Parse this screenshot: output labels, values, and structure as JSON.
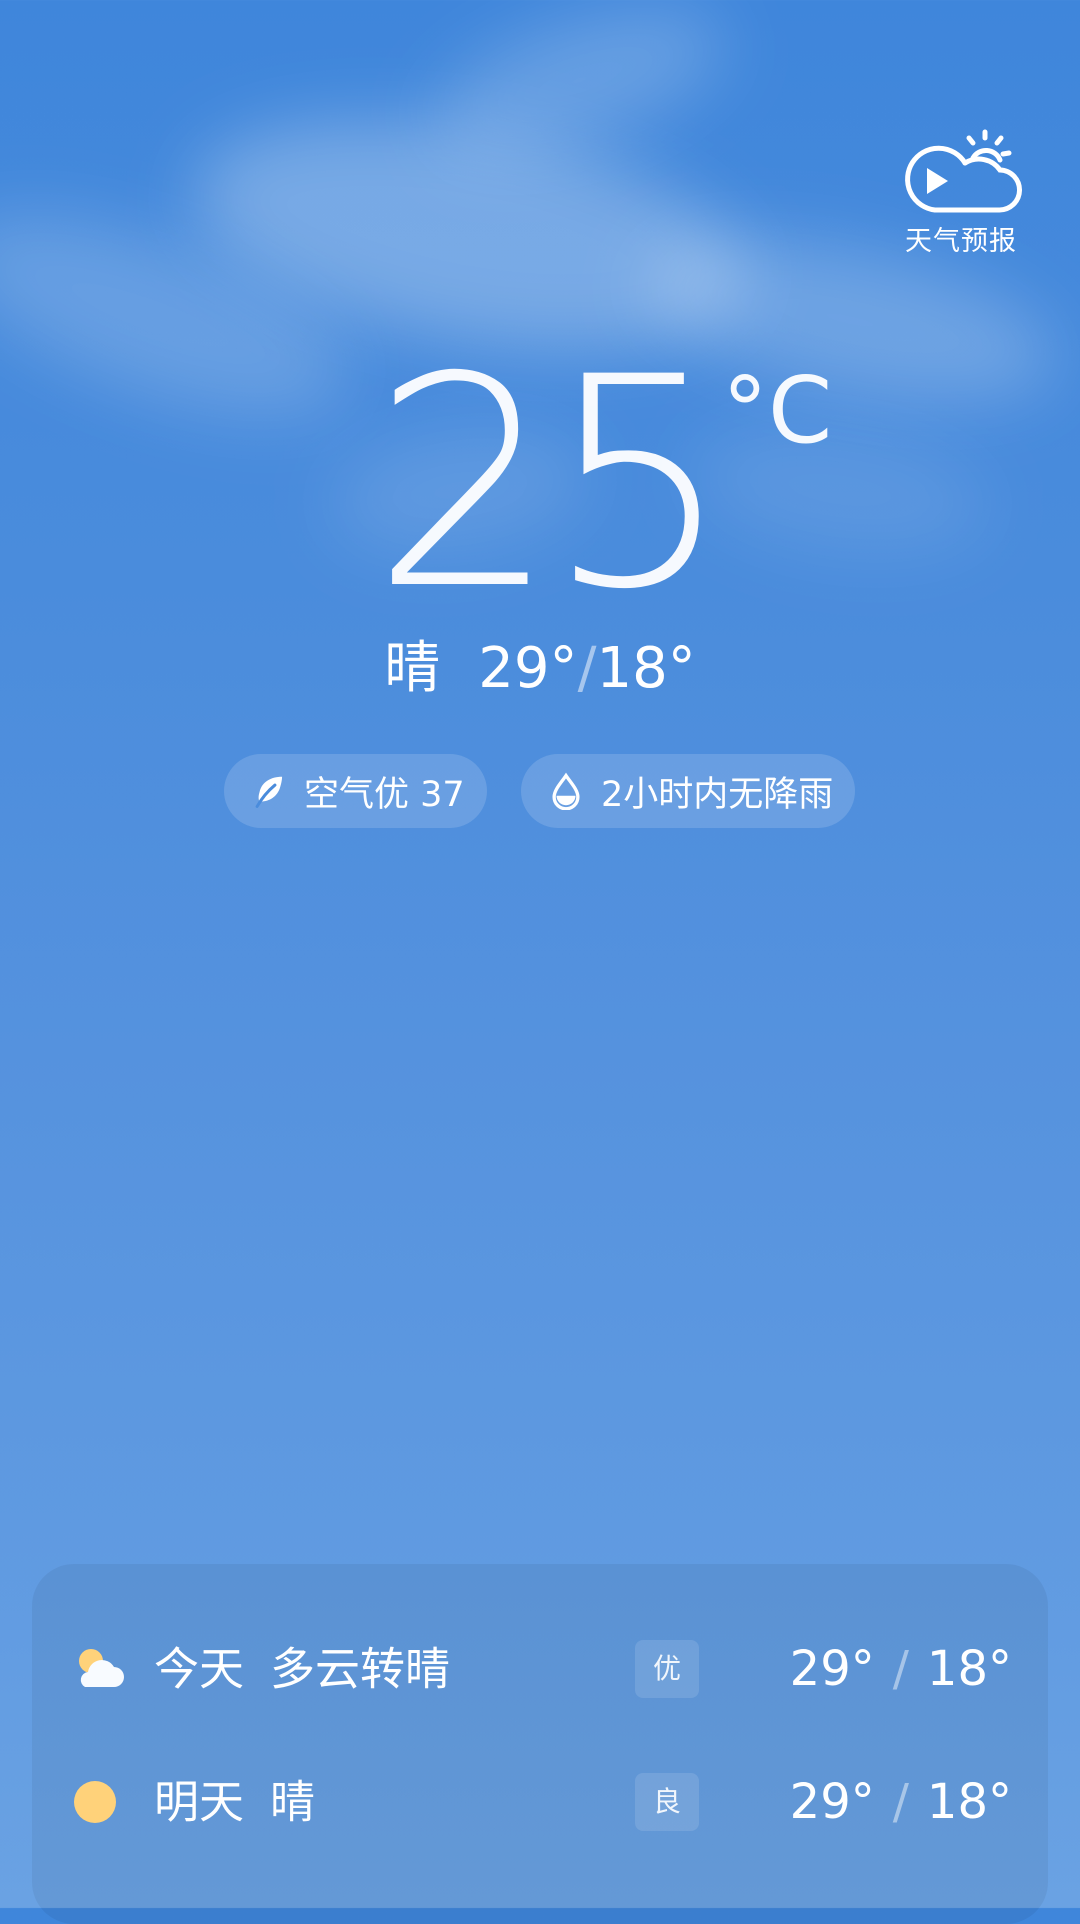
{
  "header": {
    "forecast_badge": {
      "label": "天气预报",
      "icon": "weather-forecast-video-icon"
    }
  },
  "current": {
    "temperature": "25",
    "unit": "°C",
    "condition": "晴",
    "high": "29°",
    "low": "18°",
    "separator": "/"
  },
  "chips": {
    "air_quality": {
      "label": "空气优 37",
      "icon": "leaf-icon"
    },
    "precipitation": {
      "label": "2小时内无降雨",
      "icon": "water-drop-icon"
    }
  },
  "forecast": [
    {
      "day": "今天",
      "condition": "多云转晴",
      "aqi": "优",
      "high": "29°",
      "low": "18°",
      "separator": "/",
      "icon": "partly-cloudy-icon"
    },
    {
      "day": "明天",
      "condition": "晴",
      "aqi": "良",
      "high": "29°",
      "low": "18°",
      "separator": "/",
      "icon": "sun-icon"
    }
  ],
  "colors": {
    "sky_top": "#3f86db",
    "sky_bottom": "#6aa2e3",
    "text": "#ffffff",
    "sun_yellow": "#ffd27a"
  }
}
